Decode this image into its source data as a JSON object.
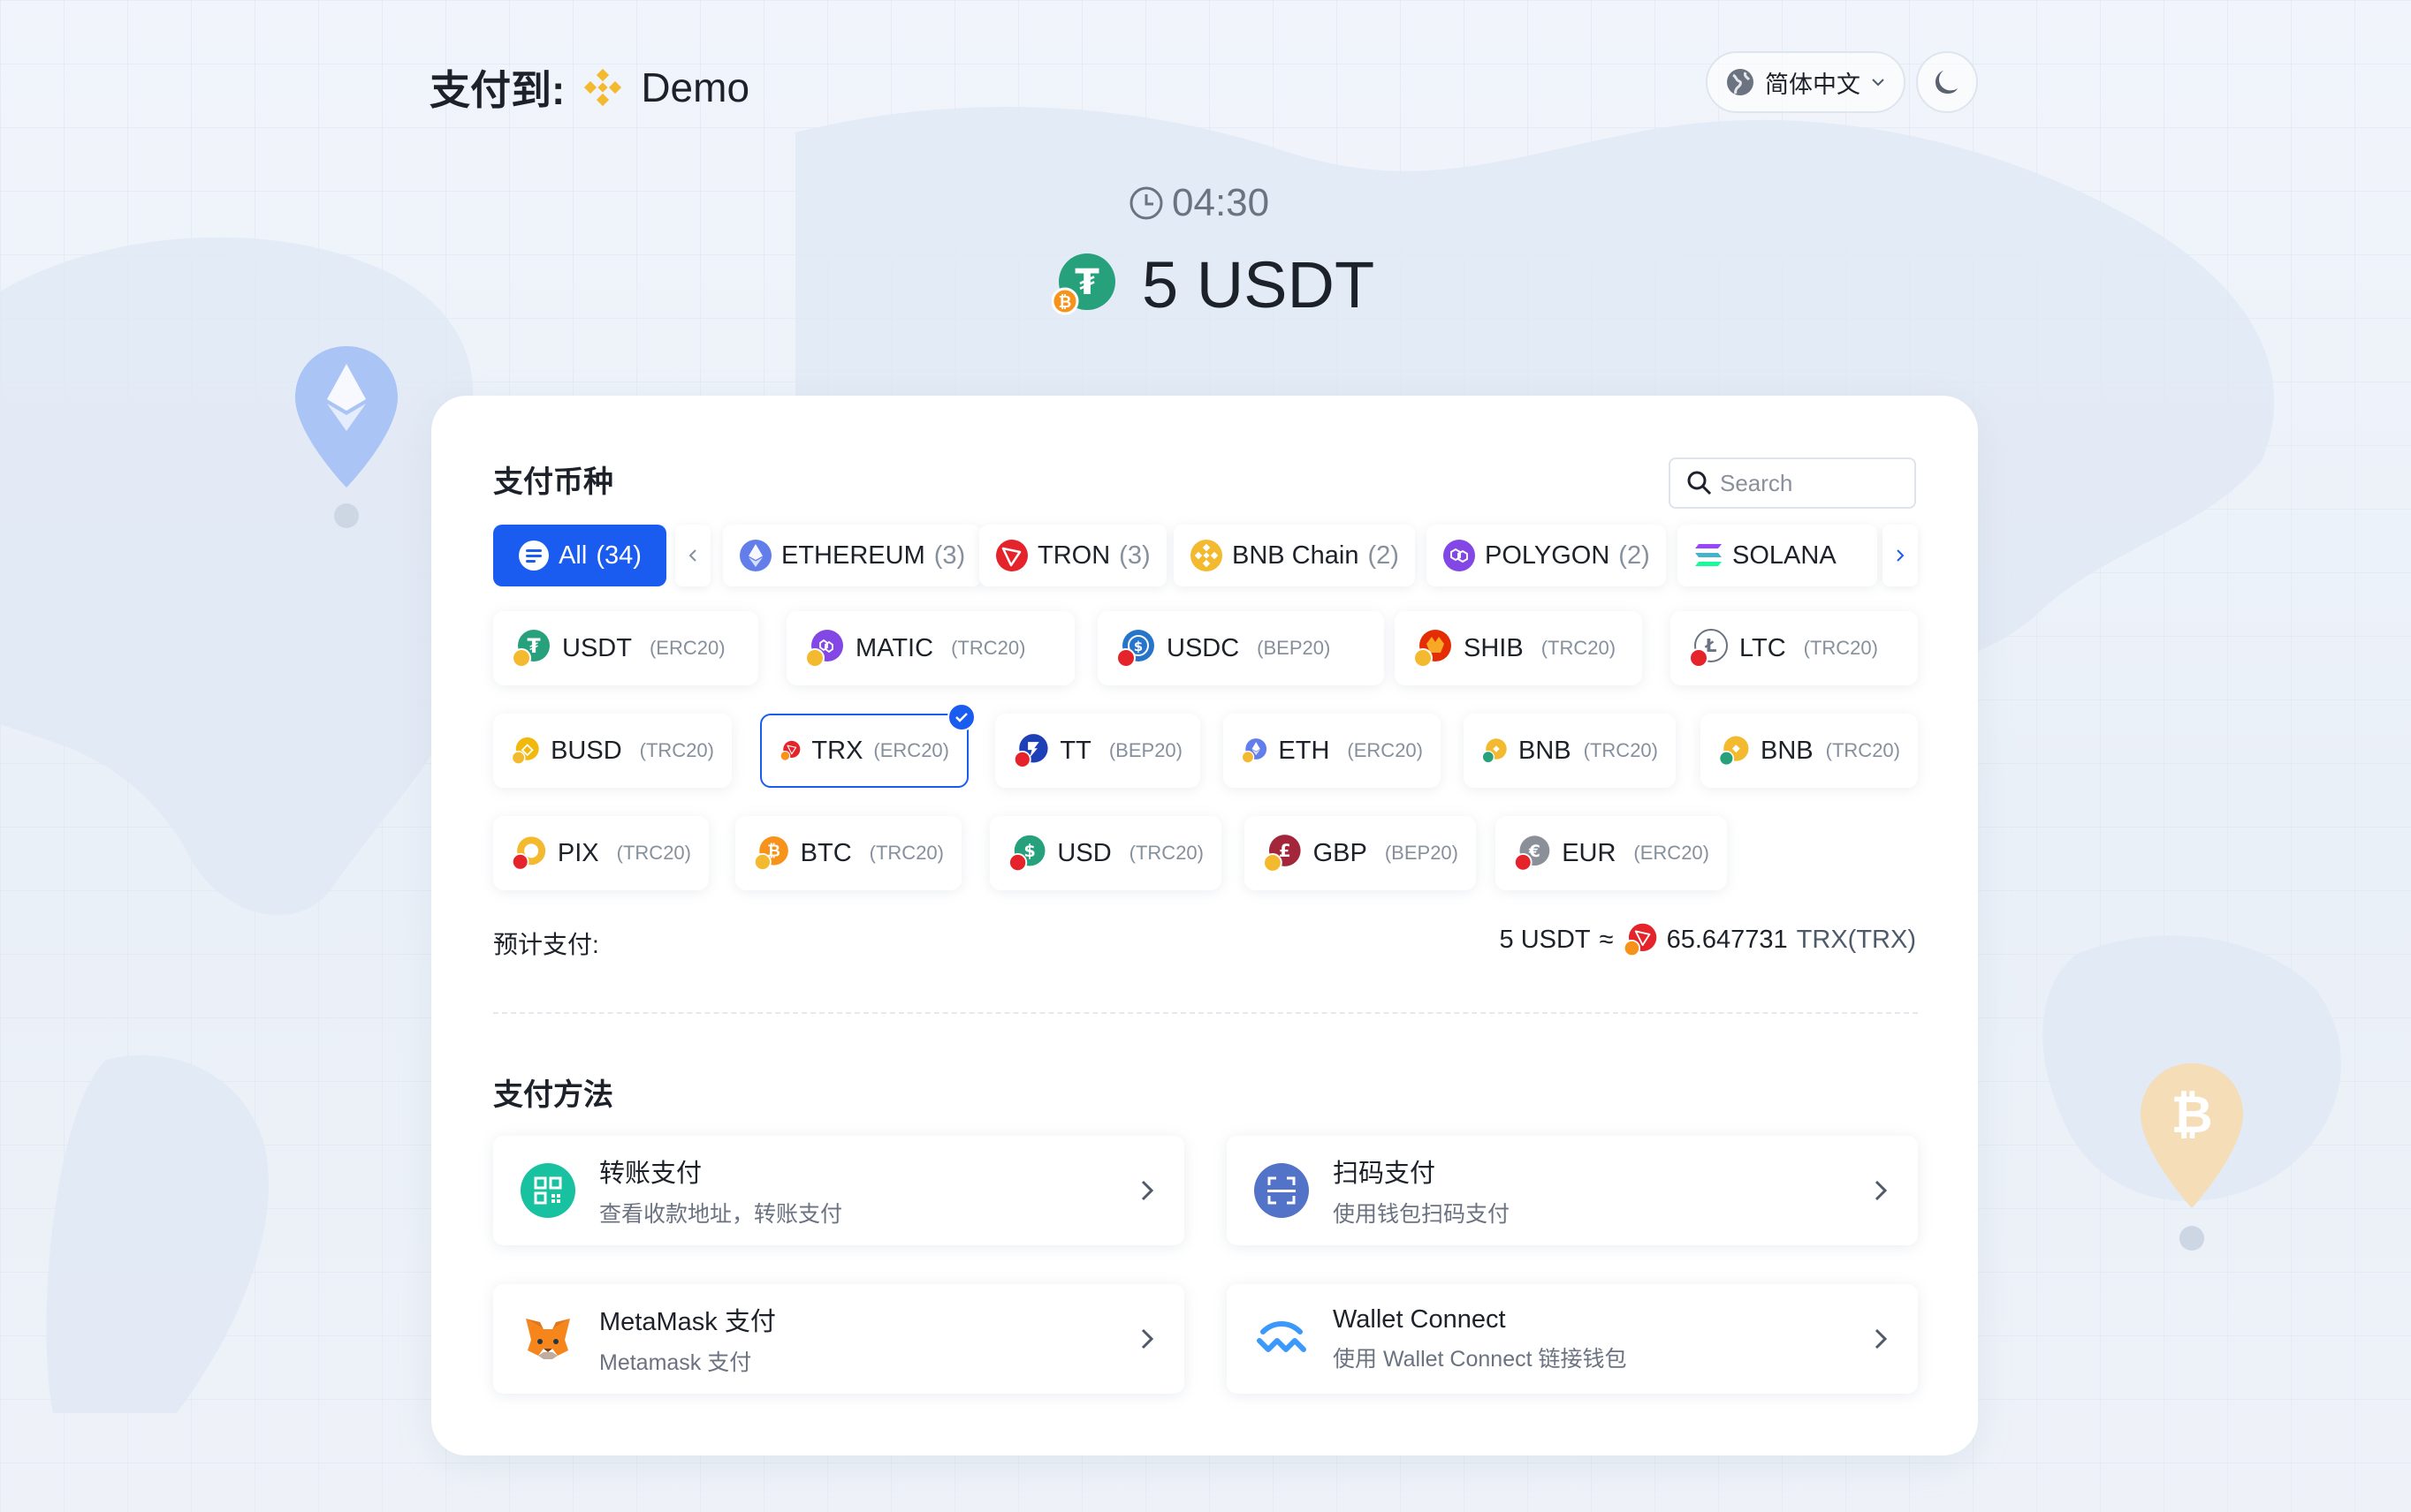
{
  "header": {
    "pay_to_label": "支付到:",
    "merchant_name": "Demo",
    "language": "简体中文"
  },
  "payment": {
    "countdown": "04:30",
    "amount": "5 USDT"
  },
  "currency_section": {
    "title": "支付币种",
    "search_placeholder": "Search",
    "networks": [
      {
        "label": "All",
        "count": "(34)"
      },
      {
        "label": "ETHEREUM",
        "count": "(3)"
      },
      {
        "label": "TRON",
        "count": "(3)"
      },
      {
        "label": "BNB Chain",
        "count": "(2)"
      },
      {
        "label": "POLYGON",
        "count": "(2)"
      },
      {
        "label": "SOLANA",
        "count": ""
      }
    ],
    "coins": [
      {
        "name": "USDT",
        "std": "(ERC20)"
      },
      {
        "name": "MATIC",
        "std": "(TRC20)"
      },
      {
        "name": "USDC",
        "std": "(BEP20)"
      },
      {
        "name": "SHIB",
        "std": "(TRC20)"
      },
      {
        "name": "LTC",
        "std": "(TRC20)"
      },
      {
        "name": "BUSD",
        "std": "(TRC20)"
      },
      {
        "name": "TRX",
        "std": "(ERC20)"
      },
      {
        "name": "TT",
        "std": "(BEP20)"
      },
      {
        "name": "ETH",
        "std": "(ERC20)"
      },
      {
        "name": "BNB",
        "std": "(TRC20)"
      },
      {
        "name": "BNB",
        "std": "(TRC20)"
      },
      {
        "name": "PIX",
        "std": "(TRC20)"
      },
      {
        "name": "BTC",
        "std": "(TRC20)"
      },
      {
        "name": "USD",
        "std": "(TRC20)"
      },
      {
        "name": "GBP",
        "std": "(BEP20)"
      },
      {
        "name": "EUR",
        "std": "(ERC20)"
      }
    ],
    "selected_coin": "TRX",
    "estimate_label": "预计支付:",
    "estimate_from": "5 USDT",
    "estimate_approx": "≈",
    "estimate_amount": "65.647731",
    "estimate_unit": "TRX(TRX)"
  },
  "method_section": {
    "title": "支付方法",
    "methods": [
      {
        "title": "转账支付",
        "desc": "查看收款地址，转账支付",
        "icon": "qr-transfer-icon"
      },
      {
        "title": "扫码支付",
        "desc": "使用钱包扫码支付",
        "icon": "scan-icon"
      },
      {
        "title": "MetaMask 支付",
        "desc": "Metamask 支付",
        "icon": "metamask-fox-icon"
      },
      {
        "title": "Wallet Connect",
        "desc": "使用 Wallet Connect 链接钱包",
        "icon": "walletconnect-icon"
      }
    ]
  },
  "colors": {
    "accent": "#1a5cf0",
    "tether": "#26a17b",
    "bnb": "#f3ba2f",
    "tron": "#e5232a",
    "eth": "#627eea",
    "polygon": "#8247e5"
  }
}
